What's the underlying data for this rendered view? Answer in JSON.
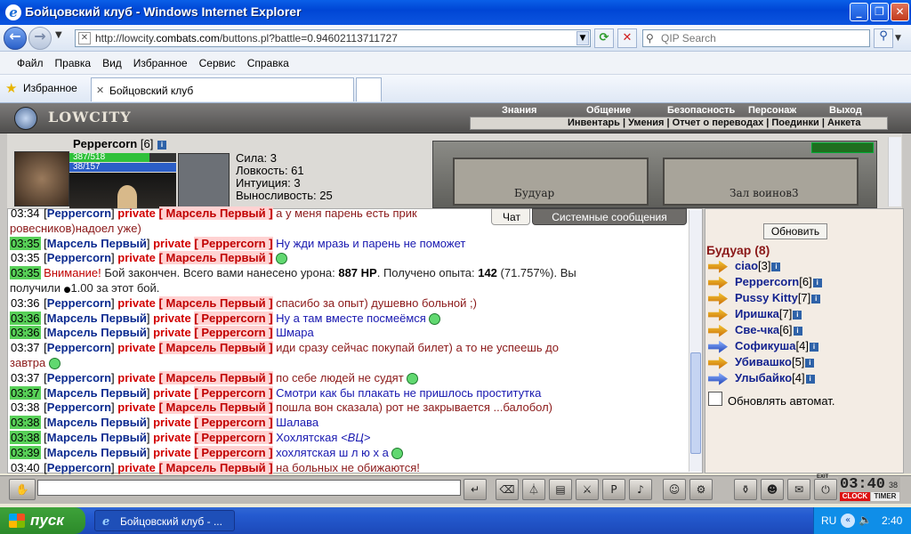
{
  "window": {
    "title": "Бойцовский клуб - Windows Internet Explorer"
  },
  "nav": {
    "url_prefix": "http://lowcity.",
    "url_domain": "combats.com",
    "url_path": "/buttons.pl?battle=0.94602113711727",
    "search_placeholder": "QIP Search"
  },
  "menu": [
    "Файл",
    "Правка",
    "Вид",
    "Избранное",
    "Сервис",
    "Справка"
  ],
  "favorites": {
    "label": "Избранное",
    "tab_title": "Бойцовский клуб"
  },
  "game": {
    "logo": "LOWCITY",
    "top_menu": [
      "Знания",
      "Общение",
      "Безопасность",
      "Персонаж",
      "Выход"
    ],
    "sub_menu": "Инвентарь | Умения | Отчет о переводах | Поединки | Анкета",
    "character": {
      "name": "Peppercorn",
      "level": "[6]",
      "hp": "387/518",
      "mana": "38/157",
      "hp_fraction": 0.747
    },
    "stats": [
      "Сила: 3",
      "Ловкость: 61",
      "Интуиция: 3",
      "Выносливость: 25"
    ],
    "scene": {
      "left_sign": "Будуар",
      "right_sign": "Зал воинов3"
    }
  },
  "chat": {
    "tabs": [
      "Чат",
      "Системные сообщения"
    ],
    "lines": [
      {
        "time": "03:34",
        "green": false,
        "sender": "Peppercorn",
        "recipient": "Марсель Первый",
        "text": "а у меня парень есть прик",
        "cont": "ровесников)надоел уже)"
      },
      {
        "time": "03:35",
        "green": true,
        "sender": "Марсель Первый",
        "recipient": "Peppercorn",
        "text": "Ну жди мразь и парень не поможет"
      },
      {
        "time": "03:35",
        "green": false,
        "sender": "Peppercorn",
        "recipient": "Марсель Первый",
        "text": "",
        "smile": true
      },
      {
        "time": "03:35",
        "green": true,
        "sys_warn": "Внимание!",
        "sys_a": " Бой закончен. Всего вами нанесено урона: ",
        "sys_dmg": "887 HP",
        "sys_b": ". Получено опыта: ",
        "sys_exp": "142",
        "sys_c": " (71.757%). Вы",
        "sys_d": "получили ",
        "sys_money": "1.00",
        "sys_e": " за этот бой."
      },
      {
        "time": "03:36",
        "green": false,
        "sender": "Peppercorn",
        "recipient": "Марсель Первый",
        "text": "спасибо за опыт) душевно больной ;)"
      },
      {
        "time": "03:36",
        "green": true,
        "sender": "Марсель Первый",
        "recipient": "Peppercorn",
        "text": "Ну а там вместе посмеёмся",
        "smile": true
      },
      {
        "time": "03:36",
        "green": true,
        "sender": "Марсель Первый",
        "recipient": "Peppercorn",
        "text": "Шмара"
      },
      {
        "time": "03:37",
        "green": false,
        "sender": "Peppercorn",
        "recipient": "Марсель Первый",
        "text": "иди сразу сейчас покупай билет) а то не успеешь до",
        "cont": "завтра",
        "cont_smile": true
      },
      {
        "time": "03:37",
        "green": false,
        "sender": "Peppercorn",
        "recipient": "Марсель Первый",
        "text": "по себе людей не судят",
        "smile": true
      },
      {
        "time": "03:37",
        "green": true,
        "sender": "Марсель Первый",
        "recipient": "Peppercorn",
        "text": "Смотри как бы плакать не пришлось проститутка"
      },
      {
        "time": "03:38",
        "green": false,
        "sender": "Peppercorn",
        "recipient": "Марсель Первый",
        "text": "пошла вон сказала) рот не закрывается ...балобол)"
      },
      {
        "time": "03:38",
        "green": true,
        "sender": "Марсель Первый",
        "recipient": "Peppercorn",
        "text": "Шалава"
      },
      {
        "time": "03:38",
        "green": true,
        "sender": "Марсель Первый",
        "recipient": "Peppercorn",
        "text": "Хохлятская ",
        "tag": "<ВЦ>"
      },
      {
        "time": "03:39",
        "green": true,
        "sender": "Марсель Первый",
        "recipient": "Peppercorn",
        "text": "хохлятская ш л ю х а",
        "smile": true
      },
      {
        "time": "03:40",
        "green": false,
        "sender": "Peppercorn",
        "recipient": "Марсель Первый",
        "text": "на больных не обижаются!"
      }
    ],
    "private_word": "private"
  },
  "users": {
    "refresh_label": "Обновить",
    "room": "Будуар (8)",
    "list": [
      {
        "name": "ciao",
        "level": "[3]",
        "color": "gold"
      },
      {
        "name": "Peppercorn",
        "level": "[6]",
        "color": "gold"
      },
      {
        "name": "Pussy Kitty",
        "level": "[7]",
        "color": "gold"
      },
      {
        "name": "Иришка",
        "level": "[7]",
        "color": "gold"
      },
      {
        "name": "Све-чка",
        "level": "[6]",
        "color": "gold"
      },
      {
        "name": "Софикуша",
        "level": "[4]",
        "color": "blue"
      },
      {
        "name": "Убивашко",
        "level": "[5]",
        "color": "gold"
      },
      {
        "name": "Улыбайко",
        "level": "[4]",
        "color": "blue"
      }
    ],
    "auto_refresh": "Обновлять автомат."
  },
  "bottom": {
    "clock": "03:40",
    "clock_sec": "38",
    "clock_label": "CLOCK",
    "timer_label": "TIMER",
    "exit_label": "EXIT"
  },
  "taskbar": {
    "start": "пуск",
    "item": "Бойцовский клуб - ...",
    "lang": "RU",
    "time": "2:40"
  }
}
